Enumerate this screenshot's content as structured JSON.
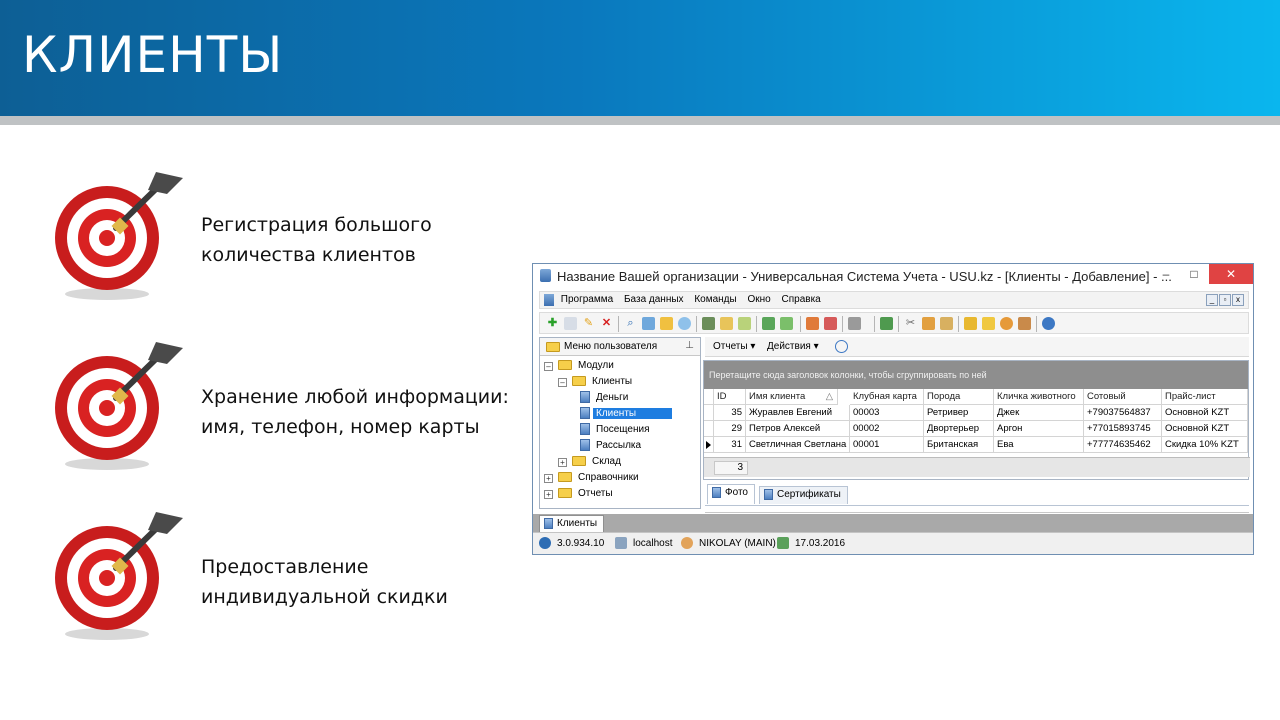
{
  "slide": {
    "title": "КЛИЕНТЫ"
  },
  "bullets": [
    {
      "line1": "Регистрация большого",
      "line2": "количества клиентов"
    },
    {
      "line1": "Хранение любой информации:",
      "line2": "имя, телефон, номер карты"
    },
    {
      "line1": "Предоставление",
      "line2": "индивидуальной скидки"
    }
  ],
  "window": {
    "title": "Название Вашей организации - Универсальная Система Учета - USU.kz - [Клиенты - Добавление] - ...",
    "minimize": "–",
    "maximize": "□",
    "close": "✕"
  },
  "menu": {
    "items": [
      "Программа",
      "База данных",
      "Команды",
      "Окно",
      "Справка"
    ]
  },
  "left_panel": {
    "header": "Меню пользователя",
    "tree": [
      "Модули",
      "Клиенты",
      "Деньги",
      "Клиенты",
      "Посещения",
      "Рассылка",
      "Склад",
      "Справочники",
      "Отчеты"
    ]
  },
  "subbar": {
    "reports": "Отчеты ▾",
    "actions": "Действия ▾"
  },
  "grid": {
    "group_hint": "Перетащите сюда заголовок колонки, чтобы сгруппировать по ней",
    "columns": [
      "ID",
      "Имя клиента",
      "Клубная карта",
      "Порода",
      "Кличка животного",
      "Сотовый",
      "Прайс-лист"
    ],
    "sort_indicator": "△",
    "rows": [
      [
        "35",
        "Журавлев Евгений",
        "00003",
        "Ретривер",
        "Джек",
        "+79037564837",
        "Основной KZT"
      ],
      [
        "29",
        "Петров Алексей",
        "00002",
        "Двортерьер",
        "Аргон",
        "+77015893745",
        "Основной KZT"
      ],
      [
        "31",
        "Светличная Светлана",
        "00001",
        "Британская",
        "Ева",
        "+77774635462",
        "Скидка 10% KZT"
      ]
    ],
    "count": "3"
  },
  "lower_tabs": [
    "Фото",
    "Сертификаты"
  ],
  "window_tab": "Клиенты",
  "status": {
    "version": "3.0.934.10",
    "server": "localhost",
    "user": "NIKOLAY (MAIN)",
    "date": "17.03.2016"
  },
  "colors": {
    "banner_start": "#0d5f95",
    "banner_end": "#0ab6ee",
    "selection": "#1e7de0",
    "close": "#e04343"
  }
}
